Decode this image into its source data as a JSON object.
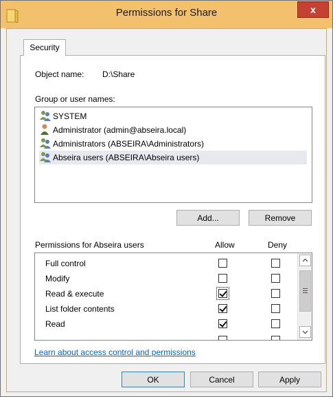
{
  "window": {
    "title": "Permissions for Share",
    "close_label": "x"
  },
  "tab": {
    "label": "Security"
  },
  "object": {
    "label": "Object name:",
    "value": "D:\\Share"
  },
  "groups": {
    "label": "Group or user names:",
    "items": [
      {
        "name": "SYSTEM",
        "icon": "users-group-icon"
      },
      {
        "name": "Administrator (admin@abseira.local)",
        "icon": "user-icon"
      },
      {
        "name": "Administrators (ABSEIRA\\Administrators)",
        "icon": "users-group-icon"
      },
      {
        "name": "Abseira users (ABSEIRA\\Abseira users)",
        "icon": "users-group-icon",
        "selected": true
      }
    ],
    "add_label": "Add...",
    "remove_label": "Remove"
  },
  "permissions": {
    "label": "Permissions for Abseira users",
    "allow_label": "Allow",
    "deny_label": "Deny",
    "rows": [
      {
        "name": "Full control",
        "allow": false,
        "deny": false
      },
      {
        "name": "Modify",
        "allow": false,
        "deny": false
      },
      {
        "name": "Read & execute",
        "allow": true,
        "deny": false
      },
      {
        "name": "List folder contents",
        "allow": true,
        "deny": false
      },
      {
        "name": "Read",
        "allow": true,
        "deny": false
      }
    ]
  },
  "link": {
    "text": "Learn about access control and permissions"
  },
  "footer": {
    "ok_label": "OK",
    "cancel_label": "Cancel",
    "apply_label": "Apply"
  },
  "colors": {
    "titlebar": "#f3c06e",
    "close": "#c44234",
    "link": "#0066cc"
  }
}
